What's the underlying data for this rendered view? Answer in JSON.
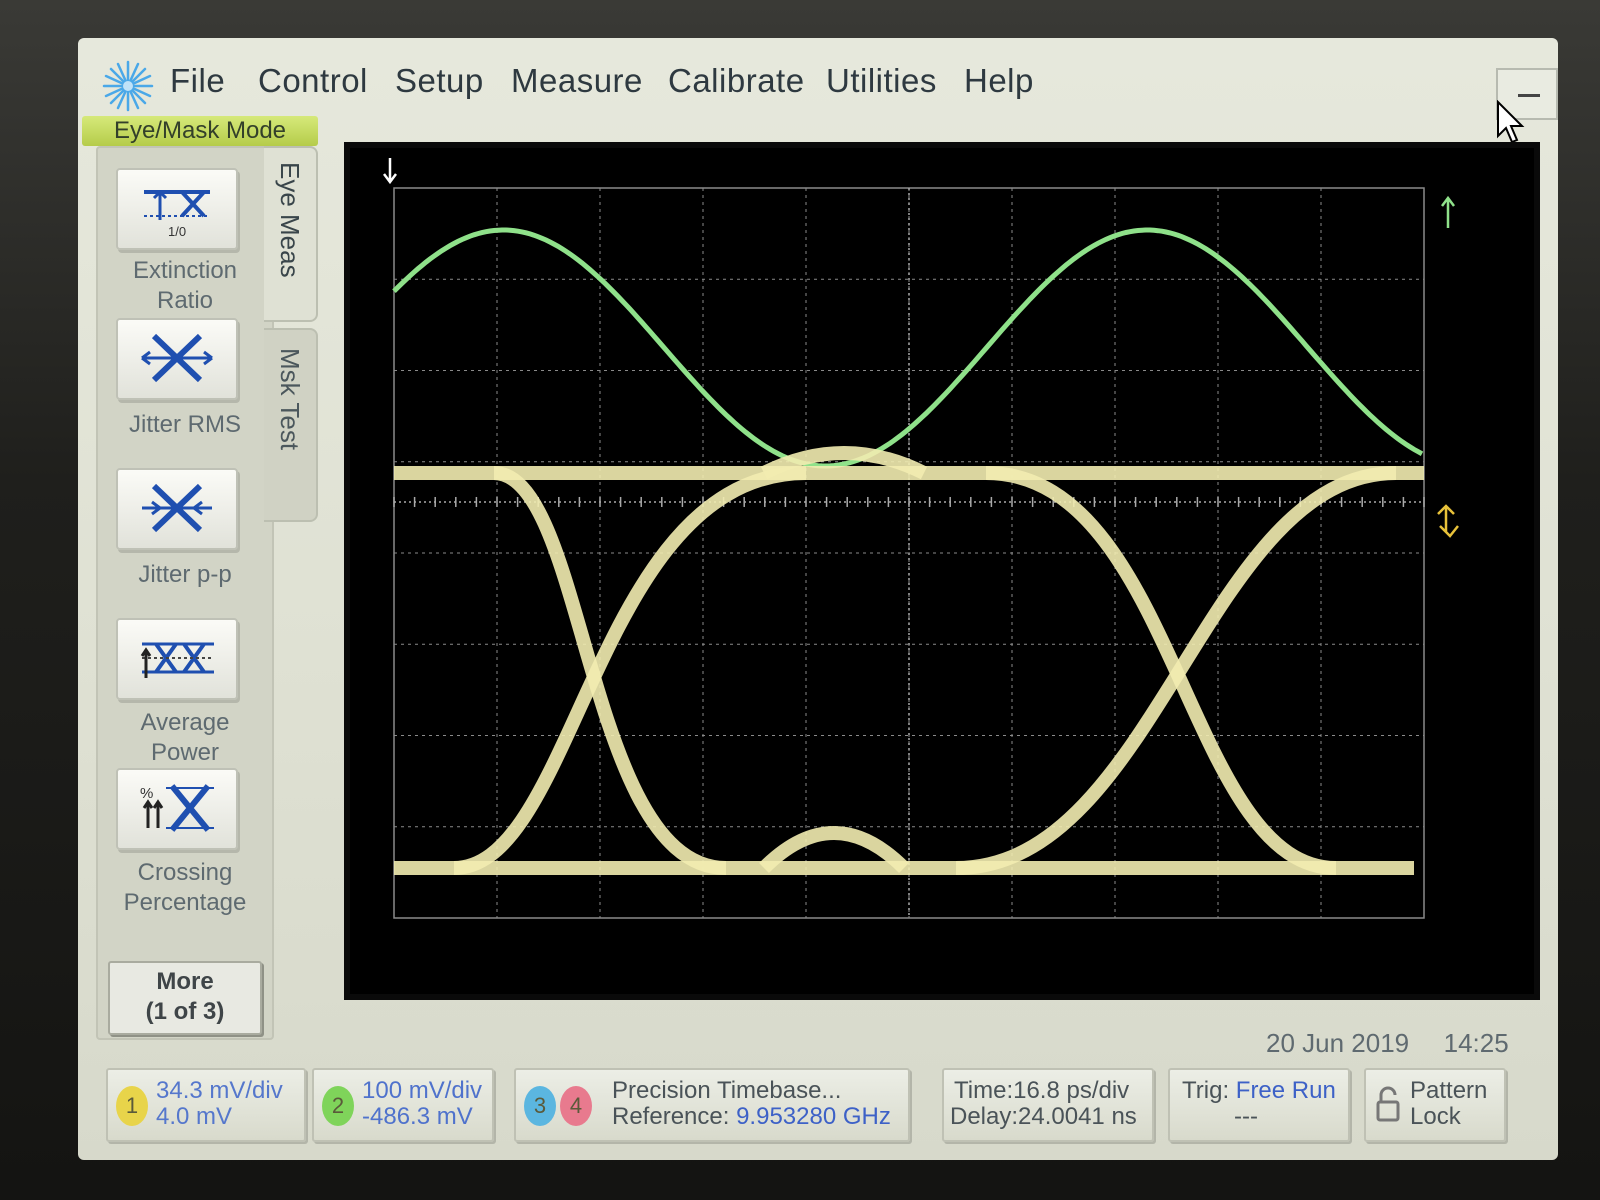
{
  "menu": {
    "items": [
      "File",
      "Control",
      "Setup",
      "Measure",
      "Calibrate",
      "Utilities",
      "Help"
    ]
  },
  "mode_label": "Eye/Mask Mode",
  "tabs": {
    "eye_meas": "Eye Meas",
    "msk_test": "Msk Test"
  },
  "measurements": [
    {
      "label": "Extinction Ratio",
      "icon": "extinction-ratio-icon",
      "icon_caption": "1/0"
    },
    {
      "label": "Jitter RMS",
      "icon": "jitter-rms-icon"
    },
    {
      "label": "Jitter p-p",
      "icon": "jitter-pp-icon"
    },
    {
      "label": "Average Power",
      "icon": "average-power-icon"
    },
    {
      "label": "Crossing Percentage",
      "icon": "crossing-percentage-icon"
    }
  ],
  "more_button": {
    "line1": "More",
    "line2": "(1 of 3)"
  },
  "datetime": {
    "date": "20 Jun 2019",
    "time": "14:25"
  },
  "channels": [
    {
      "number": "1",
      "scale": "34.3 mV/div",
      "offset": "4.0 mV",
      "color": "#e8d44a"
    },
    {
      "number": "2",
      "scale": "100 mV/div",
      "offset": "-486.3 mV",
      "color": "#7fd45a"
    },
    {
      "number": "3",
      "color": "#5bb6e0"
    },
    {
      "number": "4",
      "color": "#e87a8e"
    }
  ],
  "timebase": {
    "line1": "Precision Timebase...",
    "ref_label": "Reference:",
    "ref_value": "9.953280 GHz"
  },
  "time_settings": {
    "time": "Time:16.8 ps/div",
    "delay": "Delay:24.0041 ns"
  },
  "trigger": {
    "label": "Trig:",
    "value": "Free Run",
    "sub": "---"
  },
  "pattern_lock": {
    "line1": "Pattern",
    "line2": "Lock"
  },
  "colors": {
    "ch1_trace": "#f2ecb0",
    "ch2_trace": "#8fe18a",
    "grid": "#8a8a8a"
  }
}
